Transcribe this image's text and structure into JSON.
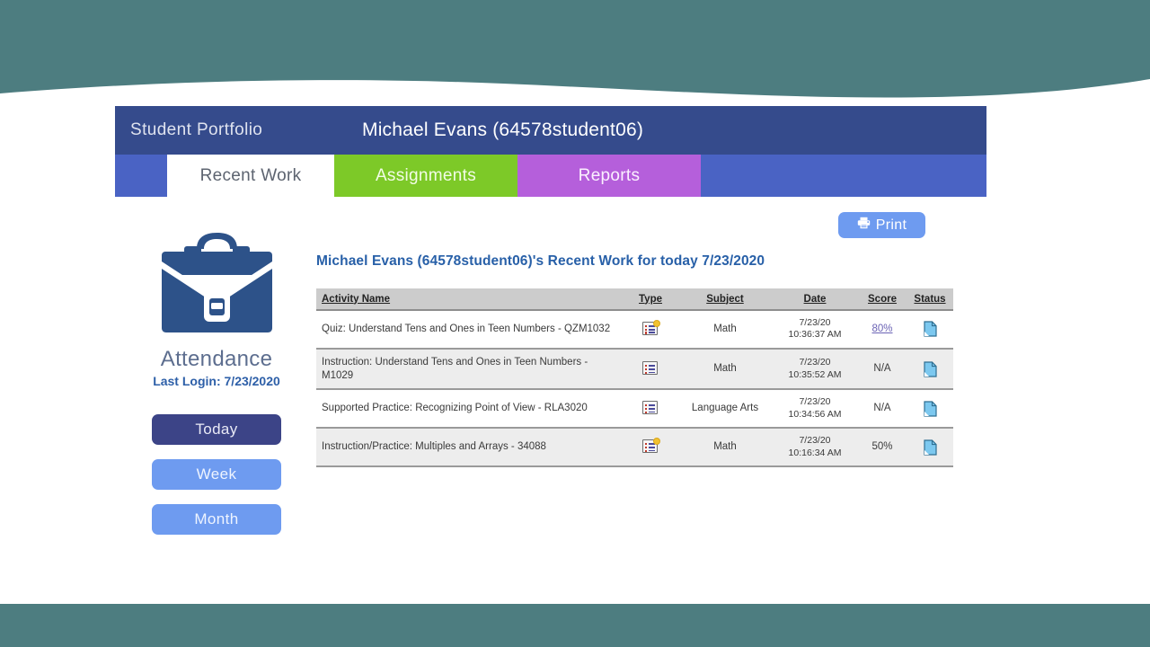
{
  "header": {
    "panel_title": "Student Portfolio",
    "student": "Michael Evans (64578student06)"
  },
  "tabs": [
    {
      "label": "Recent Work",
      "state": "active"
    },
    {
      "label": "Assignments",
      "state": "inactive"
    },
    {
      "label": "Reports",
      "state": "inactive"
    }
  ],
  "sidebar": {
    "icon": "briefcase-icon",
    "attendance_label": "Attendance",
    "last_login": "Last Login: 7/23/2020",
    "range_buttons": [
      {
        "label": "Today",
        "active": true
      },
      {
        "label": "Week",
        "active": false
      },
      {
        "label": "Month",
        "active": false
      }
    ]
  },
  "toolbar": {
    "print_label": "Print",
    "print_icon": "printer-icon"
  },
  "report": {
    "title": "Michael Evans (64578student06)'s Recent Work for today 7/23/2020"
  },
  "table": {
    "columns": [
      "Activity Name",
      "Type",
      "Subject",
      "Date",
      "Score",
      "Status"
    ],
    "rows": [
      {
        "activity": "Quiz: Understand Tens and Ones in Teen Numbers - QZM1032",
        "type_icon": "quiz-badge-icon",
        "subject": "Math",
        "date": "7/23/20\n10:36:37 AM",
        "score": "80%",
        "score_is_link": true,
        "status_icon": "document-icon"
      },
      {
        "activity": "Instruction: Understand Tens and Ones in Teen Numbers - M1029",
        "type_icon": "instruction-icon",
        "subject": "Math",
        "date": "7/23/20\n10:35:52 AM",
        "score": "N/A",
        "score_is_link": false,
        "status_icon": "document-icon"
      },
      {
        "activity": "Supported Practice: Recognizing Point of View - RLA3020",
        "type_icon": "instruction-icon",
        "subject": "Language Arts",
        "date": "7/23/20\n10:34:56 AM",
        "score": "N/A",
        "score_is_link": false,
        "status_icon": "document-icon"
      },
      {
        "activity": "Instruction/Practice: Multiples and Arrays - 34088",
        "type_icon": "quiz-badge-icon",
        "subject": "Math",
        "date": "7/23/20\n10:16:34 AM",
        "score": "50%",
        "score_is_link": false,
        "status_icon": "document-icon"
      }
    ]
  },
  "colors": {
    "teal_band": "#4d7d80",
    "header_navy": "#354b8c",
    "tabbar_blue": "#4a63c4",
    "tab_assignments": "#7dc928",
    "tab_reports": "#b55fdb",
    "button_active": "#3c4487",
    "button_idle": "#6e9bf0",
    "title_blue": "#2860a8",
    "briefcase_blue": "#2d5289",
    "score_link": "#6b63b5"
  }
}
